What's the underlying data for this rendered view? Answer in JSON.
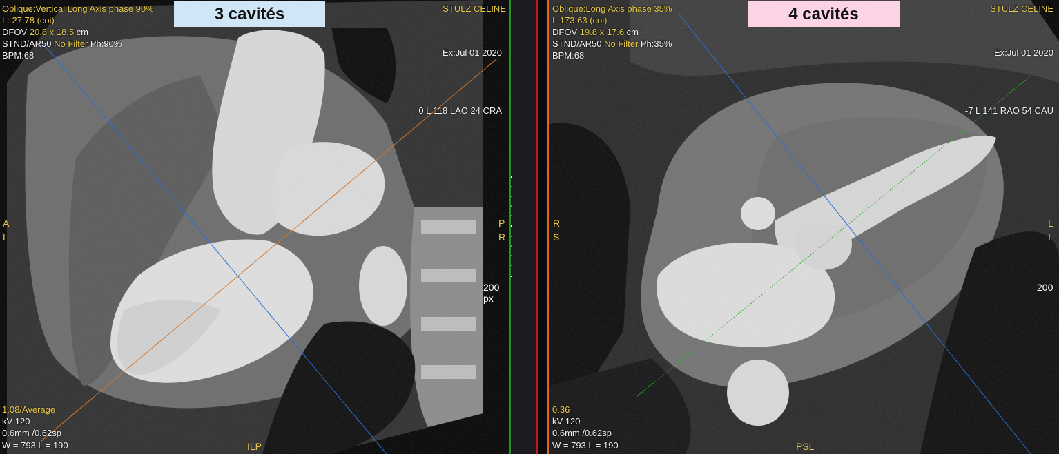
{
  "left_viewport": {
    "badge": "3 cavités",
    "badge_color": "#cfe6f7",
    "top_left": [
      "Oblique:Vertical Long Axis phase 90%",
      "L: 27.78 (coi)",
      "DFOV ",
      "20.8 x 18.5",
      " cm",
      "STND/AR50 ",
      "No Filter",
      " Ph:90%",
      "BPM:68"
    ],
    "patient": "STULZ CELINE",
    "exam_date": "Ex:Jul 01 2020",
    "angle": "0 L 118 LAO 24 CRA",
    "orient_left": [
      "A",
      "L"
    ],
    "orient_right": [
      "P",
      "R"
    ],
    "orient_bottom": "ILP",
    "scale_label": "200 px",
    "bottom_left": [
      "1.08/Average",
      "kV 120",
      "0.6mm /0.62sp",
      "W = 793 L = 190"
    ]
  },
  "right_viewport": {
    "badge": "4 cavités",
    "badge_color": "#fbd3e5",
    "top_left": [
      "Oblique:Long Axis phase 35%",
      "I: 173.63 (coi)",
      "DFOV ",
      "19.8 x 17.6",
      " cm",
      "STND/AR50 ",
      "No Filter",
      " Ph:35%",
      "BPM:68"
    ],
    "patient": "STULZ CELINE",
    "exam_date": "Ex:Jul 01 2020",
    "angle": "-7 L 141 RAO 54 CAU",
    "orient_left": [
      "R",
      "S"
    ],
    "orient_right": [
      "L",
      "I"
    ],
    "orient_bottom": "PSL",
    "scale_label": "200",
    "bottom_left": [
      "0.36",
      "kV 120",
      "0.6mm /0.62sp",
      "W = 793 L = 190"
    ]
  },
  "colors": {
    "overlay_yellow": "#e6c84a",
    "left_border": "#1f9a1f",
    "right_border_red": "#c01818",
    "right_border_orange": "#d86a1c",
    "ref_line_blue": "#2a6fd6",
    "ref_line_orange": "#d8782a",
    "ref_line_green": "#2fae2f"
  }
}
